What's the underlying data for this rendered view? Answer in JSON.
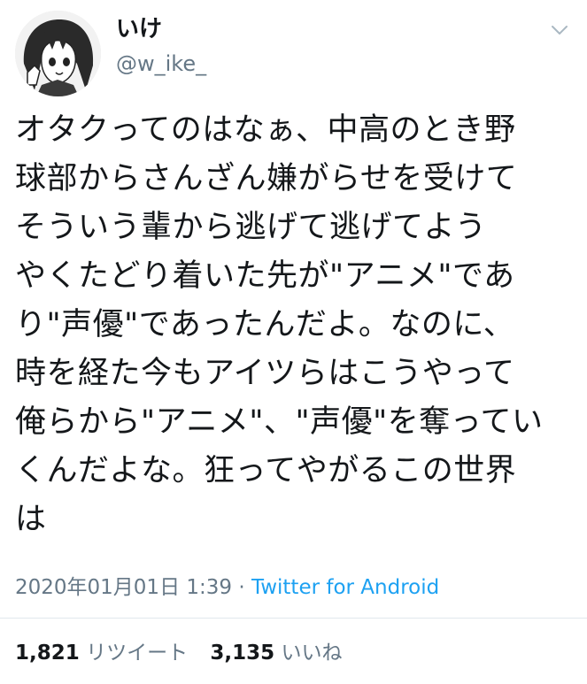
{
  "tweet": {
    "user": {
      "display_name": "いけ",
      "handle": "@w_ike_",
      "avatar_icon": "anime-avatar-icon"
    },
    "menu_icon": "chevron-down-icon",
    "body_lines": [
      "オタクってのはなぁ、中高のとき野",
      "球部からさんざん嫌がらせを受けて",
      "そういう輩から逃げて逃げてよう",
      "やくたどり着いた先が\"アニメ\"であ",
      "り\"声優\"であったんだよ。なのに、",
      "時を経た今もアイツらはこうやって",
      "俺らから\"アニメ\"、\"声優\"を奪ってい",
      "くんだよな。狂ってやがるこの世界",
      "は"
    ],
    "timestamp": "2020年01月01日 1:39",
    "separator": " · ",
    "source": "Twitter for Android",
    "stats": {
      "retweets_count": "1,821",
      "retweets_label": "リツイート",
      "likes_count": "3,135",
      "likes_label": "いいね"
    }
  },
  "colors": {
    "text_primary": "#14171a",
    "text_secondary": "#657786",
    "link": "#1da1f2",
    "divider": "#e1e8ed"
  }
}
